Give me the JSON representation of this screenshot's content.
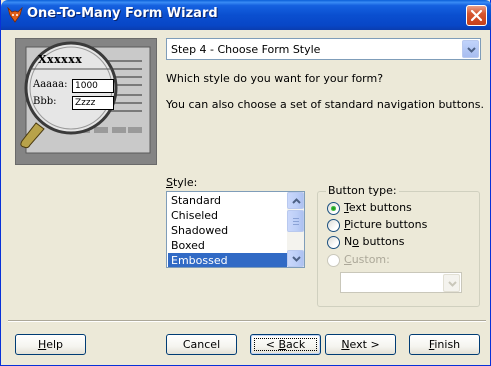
{
  "window": {
    "title": "One-To-Many Form Wizard",
    "icon": "foxpro-fox-icon",
    "accent": "#0a4fd0"
  },
  "preview": {
    "title": "Xxxxxx",
    "label_a": "Aaaaa:",
    "value_a": "1000",
    "label_b": "Bbb:",
    "value_b": "Zzzz"
  },
  "step": {
    "selected": "Step 4 - Choose Form Style"
  },
  "instructions": {
    "question": "Which style do you want for your form?",
    "navigation_note": "You can also choose a set of standard navigation buttons."
  },
  "style": {
    "label": "Style:",
    "items": [
      "Standard",
      "Chiseled",
      "Shadowed",
      "Boxed",
      "Embossed"
    ],
    "selected": "Embossed"
  },
  "button_type": {
    "legend": "Button type:",
    "options": [
      {
        "label": "Text buttons",
        "checked": true,
        "enabled": true
      },
      {
        "label": "Picture buttons",
        "checked": false,
        "enabled": true
      },
      {
        "label": "No buttons",
        "checked": false,
        "enabled": true
      },
      {
        "label": "Custom:",
        "checked": false,
        "enabled": false
      }
    ],
    "custom_value": ""
  },
  "footer": {
    "help": "Help",
    "cancel": "Cancel",
    "back": "< Back",
    "next": "Next >",
    "finish": "Finish"
  }
}
